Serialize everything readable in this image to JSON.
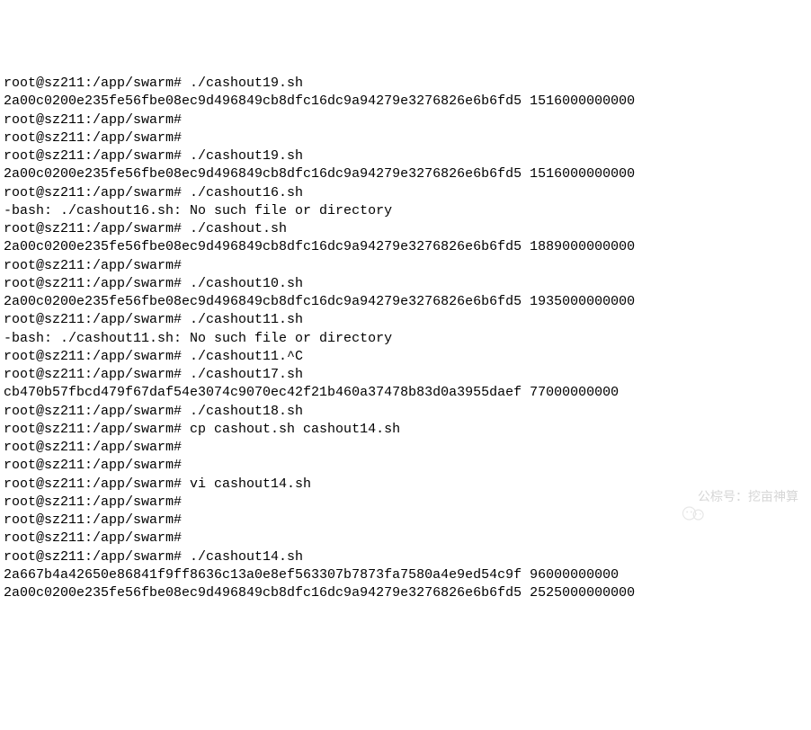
{
  "prompt": "root@sz211:/app/swarm#",
  "lines": [
    {
      "cmd": "./cashout19.sh"
    },
    {
      "out": "2a00c0200e235fe56fbe08ec9d496849cb8dfc16dc9a94279e3276826e6b6fd5 1516000000000"
    },
    {
      "cmd": ""
    },
    {
      "cmd": ""
    },
    {
      "cmd": "./cashout19.sh"
    },
    {
      "out": "2a00c0200e235fe56fbe08ec9d496849cb8dfc16dc9a94279e3276826e6b6fd5 1516000000000"
    },
    {
      "cmd": "./cashout16.sh"
    },
    {
      "out": "-bash: ./cashout16.sh: No such file or directory"
    },
    {
      "cmd": "./cashout.sh"
    },
    {
      "out": "2a00c0200e235fe56fbe08ec9d496849cb8dfc16dc9a94279e3276826e6b6fd5 1889000000000"
    },
    {
      "cmd": ""
    },
    {
      "cmd": "./cashout10.sh"
    },
    {
      "out": "2a00c0200e235fe56fbe08ec9d496849cb8dfc16dc9a94279e3276826e6b6fd5 1935000000000"
    },
    {
      "cmd": "./cashout11.sh"
    },
    {
      "out": "-bash: ./cashout11.sh: No such file or directory"
    },
    {
      "cmd": "./cashout11.^C"
    },
    {
      "cmd": "./cashout17.sh"
    },
    {
      "out": "cb470b57fbcd479f67daf54e3074c9070ec42f21b460a37478b83d0a3955daef 77000000000"
    },
    {
      "cmd": "./cashout18.sh"
    },
    {
      "cmd": "cp cashout.sh cashout14.sh"
    },
    {
      "cmd": ""
    },
    {
      "cmd": ""
    },
    {
      "cmd": "vi cashout14.sh"
    },
    {
      "cmd": ""
    },
    {
      "cmd": ""
    },
    {
      "cmd": ""
    },
    {
      "cmd": "./cashout14.sh"
    },
    {
      "out": "2a667b4a42650e86841f9ff8636c13a0e8ef563307b7873fa7580a4e9ed54c9f 96000000000"
    },
    {
      "out": "2a00c0200e235fe56fbe08ec9d496849cb8dfc16dc9a94279e3276826e6b6fd5 2525000000000"
    }
  ],
  "watermark": {
    "label": "公棕号：挖亩神算"
  }
}
